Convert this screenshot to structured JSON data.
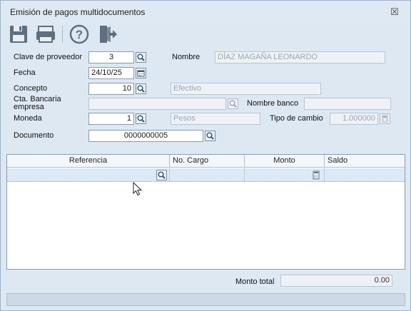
{
  "window": {
    "title": "Emisión de pagos multidocumentos",
    "close_glyph": "☒"
  },
  "toolbar": {
    "buttons": [
      {
        "icon": "save-icon"
      },
      {
        "icon": "print-icon"
      },
      {
        "icon": "help-icon"
      },
      {
        "icon": "exit-icon"
      }
    ]
  },
  "form": {
    "proveedor": {
      "label": "Clave de proveedor",
      "value": "3"
    },
    "nombre": {
      "label": "Nombre",
      "value": "DÍAZ MAGAÑA LEONARDO"
    },
    "fecha": {
      "label": "Fecha",
      "value": "24/10/25"
    },
    "concepto": {
      "label": "Concepto",
      "value": "10",
      "description": "Efectivo"
    },
    "cta_bancaria": {
      "label": "Cta. Bancaria empresa",
      "value": ""
    },
    "nombre_banco": {
      "label": "Nombre banco",
      "value": ""
    },
    "moneda": {
      "label": "Moneda",
      "value": "1",
      "description": "Pesos"
    },
    "tipo_cambio": {
      "label": "Tipo de cambio",
      "value": "1.000000"
    },
    "documento": {
      "label": "Documento",
      "value": "0000000005"
    }
  },
  "grid": {
    "columns": [
      "Referencia",
      "No. Cargo",
      "Monto",
      "Saldo"
    ]
  },
  "totals": {
    "label": "Monto total",
    "value": "0.00"
  }
}
